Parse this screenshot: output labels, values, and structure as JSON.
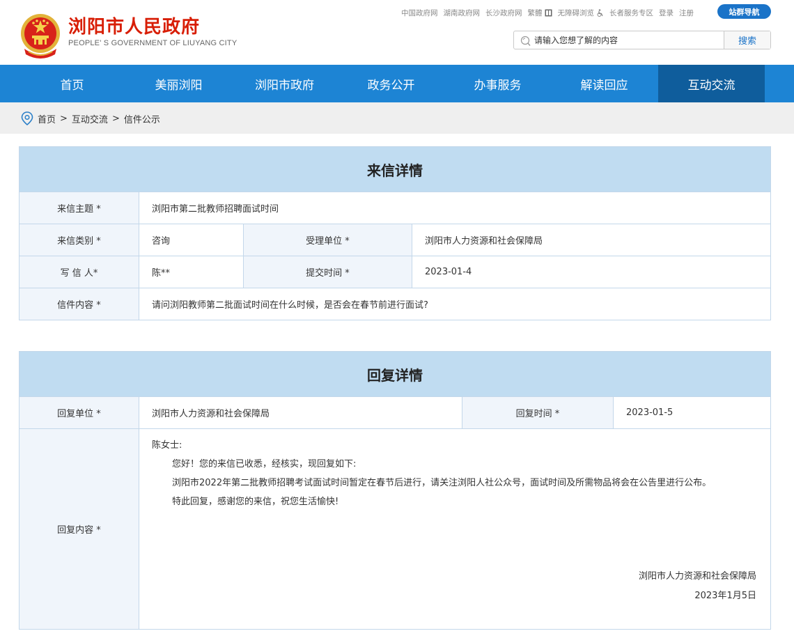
{
  "header": {
    "title": "浏阳市人民政府",
    "subtitle": "PEOPLE'  S GOVERNMENT OF LIUYANG CITY",
    "top_links": [
      "中国政府网",
      "湖南政府网",
      "长沙政府网",
      "繁體",
      "无障碍浏览",
      "长者服务专区",
      "登录",
      "注册"
    ],
    "nav_guide": "站群导航",
    "search_placeholder": "请输入您想了解的内容",
    "search_button": "搜索"
  },
  "nav": {
    "items": [
      "首页",
      "美丽浏阳",
      "浏阳市政府",
      "政务公开",
      "办事服务",
      "解读回应",
      "互动交流"
    ],
    "active": "互动交流"
  },
  "breadcrumb": {
    "items": [
      "首页",
      "互动交流",
      "信件公示"
    ],
    "separator": ">"
  },
  "letter": {
    "title": "来信详情",
    "subject_label": "来信主题 *",
    "subject": "浏阳市第二批教师招聘面试时间",
    "category_label": "来信类别 *",
    "category": "咨询",
    "unit_label": "受理单位 *",
    "unit": "浏阳市人力资源和社会保障局",
    "writer_label": "写 信 人*",
    "writer": "陈**",
    "time_label": "提交时间 *",
    "time": "2023-01-4",
    "content_label": "信件内容 *",
    "content": "请问浏阳教师第二批面试时间在什么时候，是否会在春节前进行面试?"
  },
  "reply": {
    "title": "回复详情",
    "unit_label": "回复单位 *",
    "unit": "浏阳市人力资源和社会保障局",
    "time_label": "回复时间 *",
    "time": "2023-01-5",
    "content_label": "回复内容 *",
    "greeting": "陈女士:",
    "para1": "您好！您的来信已收悉，经核实，现回复如下:",
    "para2": "浏阳市2022年第二批教师招聘考试面试时间暂定在春节后进行，请关注浏阳人社公众号，面试时间及所需物品将会在公告里进行公布。",
    "para3": "特此回复，感谢您的来信，祝您生活愉快!",
    "sign_unit": "浏阳市人力资源和社会保障局",
    "sign_date": "2023年1月5日"
  },
  "colors": {
    "brand_red": "#d81e06",
    "nav_blue": "#1d84d4",
    "nav_active": "#0f5d9c",
    "table_head": "#c0dcf1",
    "label_bg": "#f0f5fb"
  }
}
